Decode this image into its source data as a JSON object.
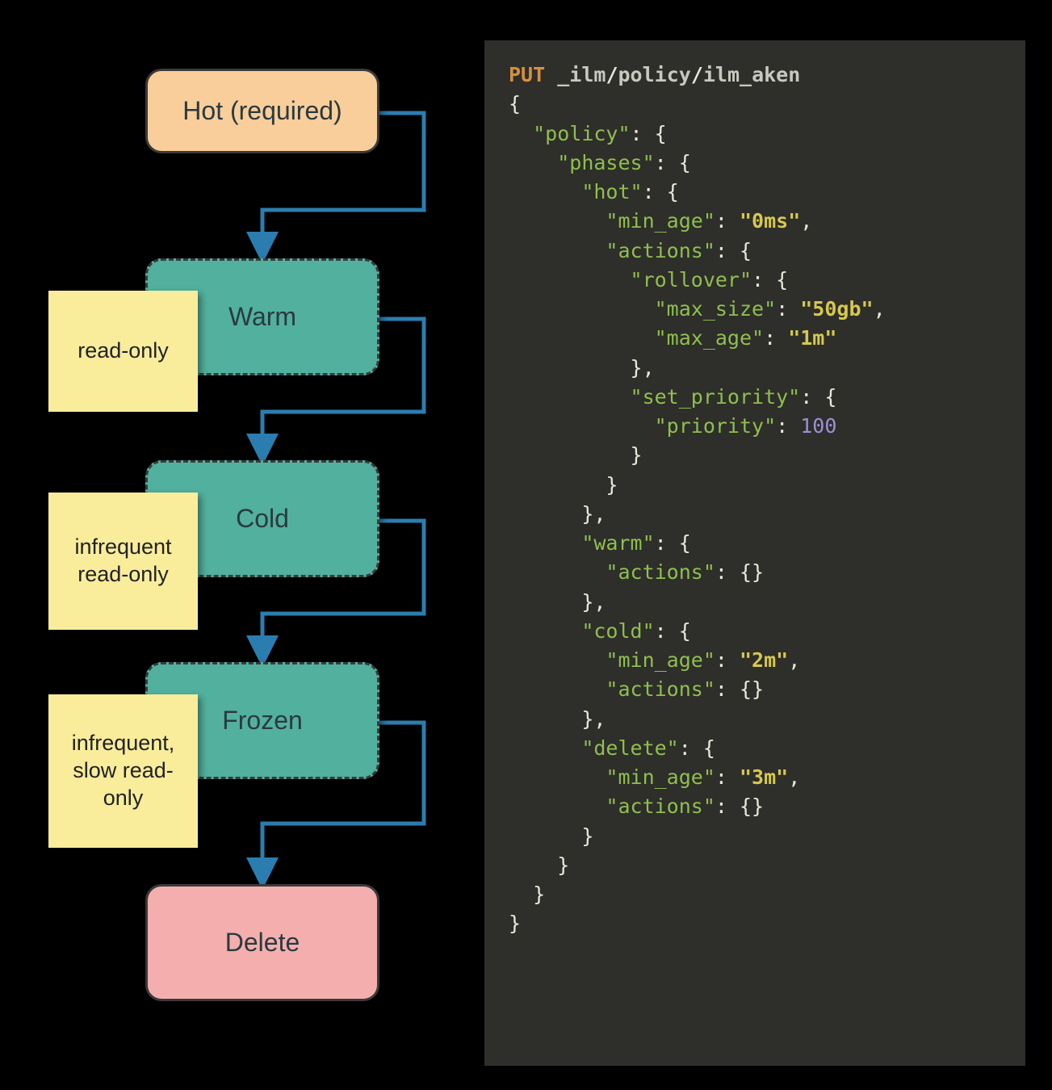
{
  "diagram": {
    "nodes": {
      "hot": {
        "label": "Hot (required)"
      },
      "warm": {
        "label": "Warm",
        "note": "read-only"
      },
      "cold": {
        "label": "Cold",
        "note": "infrequent read-only"
      },
      "frozen": {
        "label": "Frozen",
        "note": "infrequent, slow read-only"
      },
      "delete": {
        "label": "Delete"
      }
    },
    "arrow_color": "#2b7db0"
  },
  "code": {
    "method": "PUT",
    "path_prefix": "_ilm",
    "path_mid": "policy",
    "path_suffix": "ilm_aken",
    "policy": {
      "policy": {
        "phases": {
          "hot": {
            "min_age": "0ms",
            "actions": {
              "rollover": {
                "max_size": "50gb",
                "max_age": "1m"
              },
              "set_priority": {
                "priority": 100
              }
            }
          },
          "warm": {
            "actions": {}
          },
          "cold": {
            "min_age": "2m",
            "actions": {}
          },
          "delete": {
            "min_age": "3m",
            "actions": {}
          }
        }
      }
    }
  }
}
